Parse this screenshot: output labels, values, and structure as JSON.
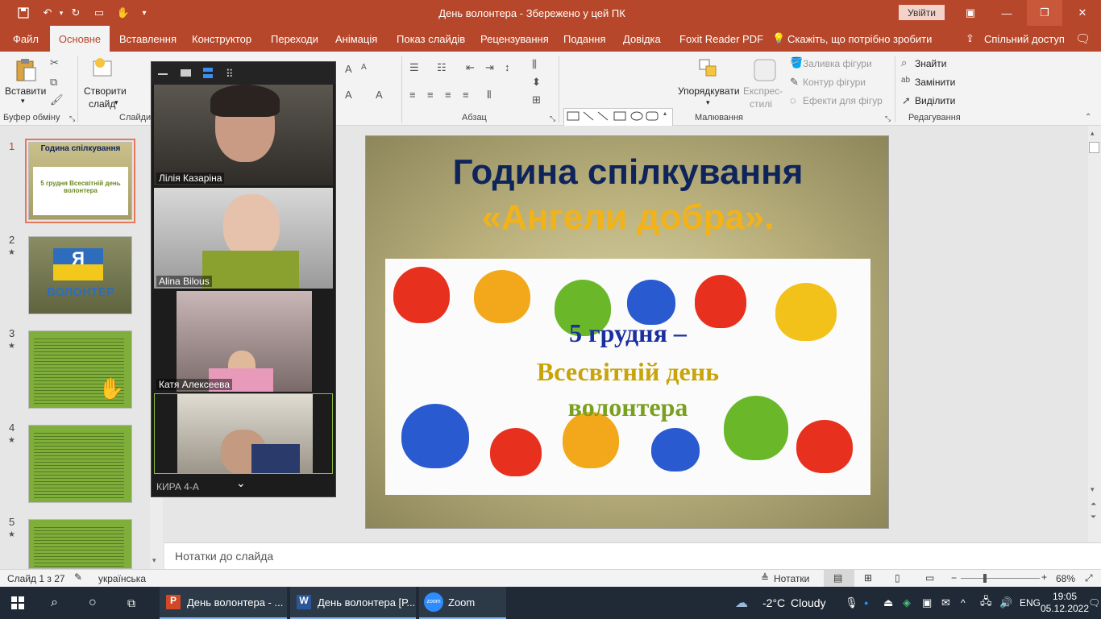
{
  "titlebar": {
    "title": "День волонтера  -  Збережено у цей ПК",
    "signin": "Увійти"
  },
  "menu": {
    "file": "Файл",
    "tabs": [
      "Основне",
      "Вставлення",
      "Конструктор",
      "Переходи",
      "Анімація",
      "Показ слайдів",
      "Рецензування",
      "Подання",
      "Довідка",
      "Foxit Reader PDF"
    ],
    "tell_me": "Скажіть, що потрібно зробити",
    "share": "Спільний доступ"
  },
  "ribbon": {
    "paste": "Вставити",
    "clipboard": "Буфер обміну",
    "new_slide_1": "Створити",
    "new_slide_2": "слайд",
    "slides_group": "Слайди",
    "paragraph_group": "Абзац",
    "drawing_group": "Малювання",
    "editing_group": "Редагування",
    "arrange": "Упорядкувати",
    "quick_styles_1": "Експрес-",
    "quick_styles_2": "стилі",
    "shape_fill": "Заливка фігури",
    "shape_outline": "Контур фігури",
    "shape_effects": "Ефекти для фігур",
    "find": "Знайти",
    "replace": "Замінити",
    "select": "Виділити"
  },
  "thumbnails": [
    {
      "num": "1",
      "star": "",
      "label_a": "Година спілкування",
      "label_b": "5 грудня Всесвітній день волонтера"
    },
    {
      "num": "2",
      "star": "★",
      "label_a": "Я",
      "label_b": "ВОЛОНТЕР"
    },
    {
      "num": "3",
      "star": "★"
    },
    {
      "num": "4",
      "star": "★"
    },
    {
      "num": "5",
      "star": "★"
    }
  ],
  "slide": {
    "title": "Година спілкування",
    "subtitle": "«Ангели добра».",
    "date": "5 грудня –",
    "day": "Всесвітній день",
    "vol": "волонтера"
  },
  "notes": {
    "placeholder": "Нотатки до слайда"
  },
  "status": {
    "slide_info": "Слайд 1 з 27",
    "language": "українська",
    "notes": "Нотатки",
    "zoom": "68%"
  },
  "zoom_panel": {
    "participants": [
      "Лілія Казаріна",
      "Alina Bilous",
      "Катя Алексеева",
      "КИРА 4-А"
    ]
  },
  "taskbar": {
    "apps": [
      "День волонтера - ...",
      "День волонтера [Р...",
      "Zoom"
    ],
    "weather_temp": "-2°C",
    "weather_desc": "Cloudy",
    "lang": "ENG",
    "time": "19:05",
    "date": "05.12.2022"
  },
  "colors": {
    "accent": "#b7472a",
    "slide_title": "#10245c",
    "slide_subtitle": "#f2b21a"
  }
}
